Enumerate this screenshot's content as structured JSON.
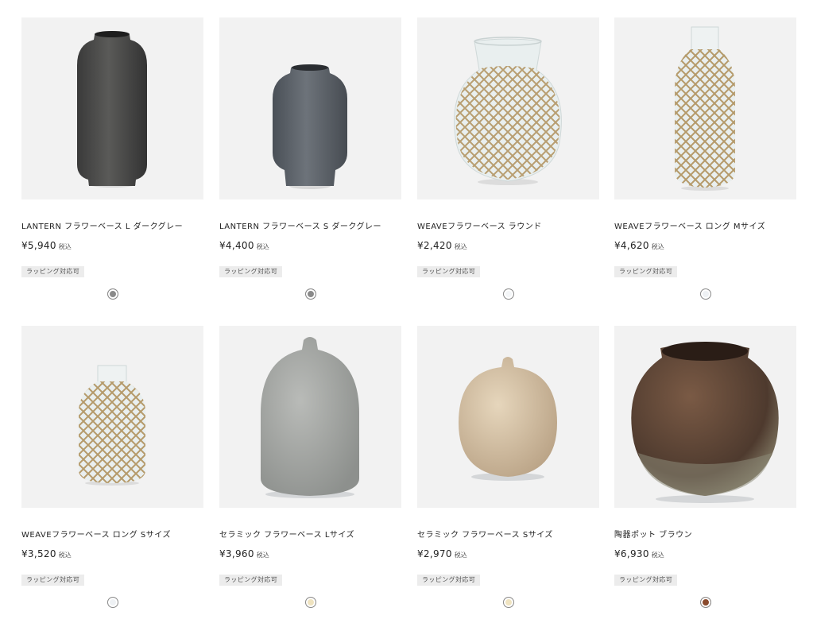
{
  "products": [
    {
      "name": "LANTERN フラワーベース L ダークグレー",
      "price": "¥5,940",
      "tax": "税込",
      "badge": "ラッピング対応可",
      "swatch_color": "#8a8a8a",
      "image_icon": "dark-gray-tall-vase"
    },
    {
      "name": "LANTERN フラワーベース S ダークグレー",
      "price": "¥4,400",
      "tax": "税込",
      "badge": "ラッピング対応可",
      "swatch_color": "#8a8a8a",
      "image_icon": "slate-gray-short-vase"
    },
    {
      "name": "WEAVEフラワーベース ラウンド",
      "price": "¥2,420",
      "tax": "税込",
      "badge": "ラッピング対応可",
      "swatch_color": "#f4f6f8",
      "image_icon": "woven-round-glass-vase"
    },
    {
      "name": "WEAVEフラワーベース ロング Mサイズ",
      "price": "¥4,620",
      "tax": "税込",
      "badge": "ラッピング対応可",
      "swatch_color": "#eef1f4",
      "image_icon": "woven-long-glass-vase"
    },
    {
      "name": "WEAVEフラワーベース ロング Sサイズ",
      "price": "¥3,520",
      "tax": "税込",
      "badge": "ラッピング対応可",
      "swatch_color": "#eef1f4",
      "image_icon": "woven-small-glass-vase"
    },
    {
      "name": "セラミック フラワーベース Lサイズ",
      "price": "¥3,960",
      "tax": "税込",
      "badge": "ラッピング対応可",
      "swatch_color": "#efe3c0",
      "image_icon": "gray-ceramic-bottle-vase"
    },
    {
      "name": "セラミック フラワーベース Sサイズ",
      "price": "¥2,970",
      "tax": "税込",
      "badge": "ラッピング対応可",
      "swatch_color": "#efe3c0",
      "image_icon": "beige-ceramic-round-vase"
    },
    {
      "name": "陶器ポット ブラウン",
      "price": "¥6,930",
      "tax": "税込",
      "badge": "ラッピング対応可",
      "swatch_color": "#8a4a2c",
      "image_icon": "brown-ceramic-pot"
    }
  ]
}
